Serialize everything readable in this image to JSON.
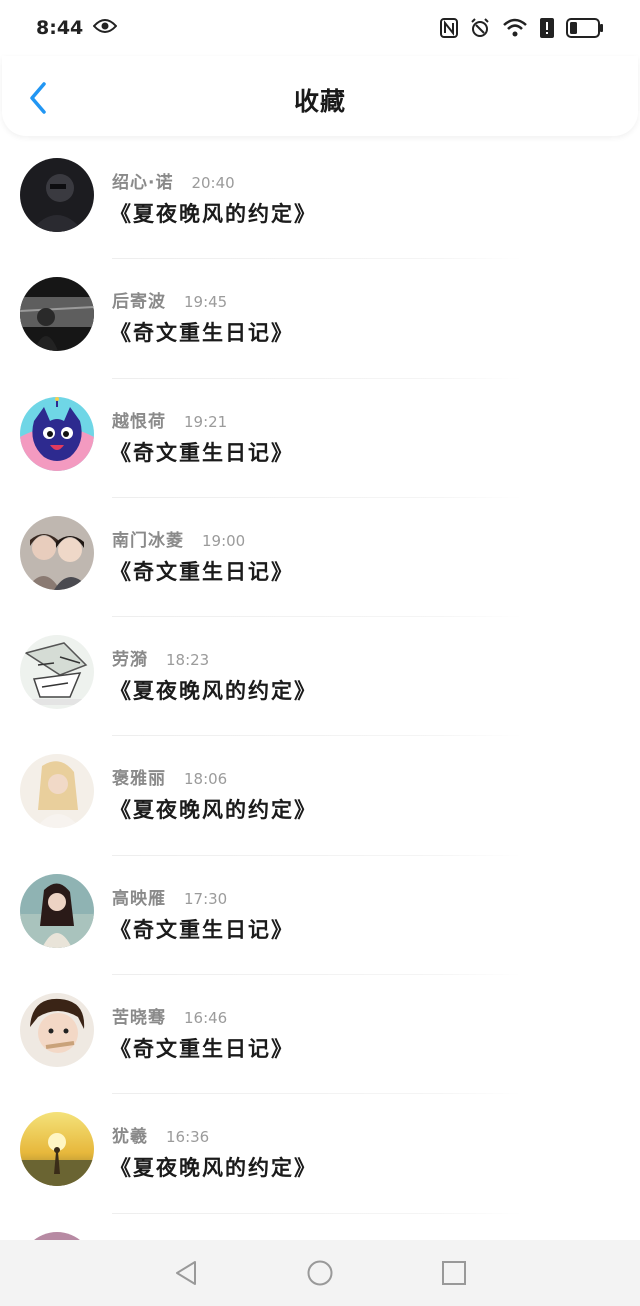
{
  "status_bar": {
    "time": "8:44",
    "icons": [
      "eye-icon",
      "nfc-icon",
      "alarm-icon",
      "wifi-icon",
      "alert-icon",
      "battery-icon"
    ]
  },
  "header": {
    "title": "收藏",
    "back_icon": "chevron-left-icon",
    "accent_color": "#2196f3"
  },
  "favorites": [
    {
      "name": "绍心·诺",
      "time": "20:40",
      "book": "《夏夜晚风的约定》"
    },
    {
      "name": "后寄波",
      "time": "19:45",
      "book": "《奇文重生日记》"
    },
    {
      "name": "越恨荷",
      "time": "19:21",
      "book": "《奇文重生日记》"
    },
    {
      "name": "南门冰菱",
      "time": "19:00",
      "book": "《奇文重生日记》"
    },
    {
      "name": "劳漪",
      "time": "18:23",
      "book": "《夏夜晚风的约定》"
    },
    {
      "name": "褒雅丽",
      "time": "18:06",
      "book": "《夏夜晚风的约定》"
    },
    {
      "name": "高映雁",
      "time": "17:30",
      "book": "《奇文重生日记》"
    },
    {
      "name": "苦晓骞",
      "time": "16:46",
      "book": "《奇文重生日记》"
    },
    {
      "name": "犹羲",
      "time": "16:36",
      "book": "《夏夜晚风的约定》"
    }
  ],
  "nav_bar": {
    "icons": [
      "back-triangle-icon",
      "home-circle-icon",
      "recents-square-icon"
    ]
  }
}
